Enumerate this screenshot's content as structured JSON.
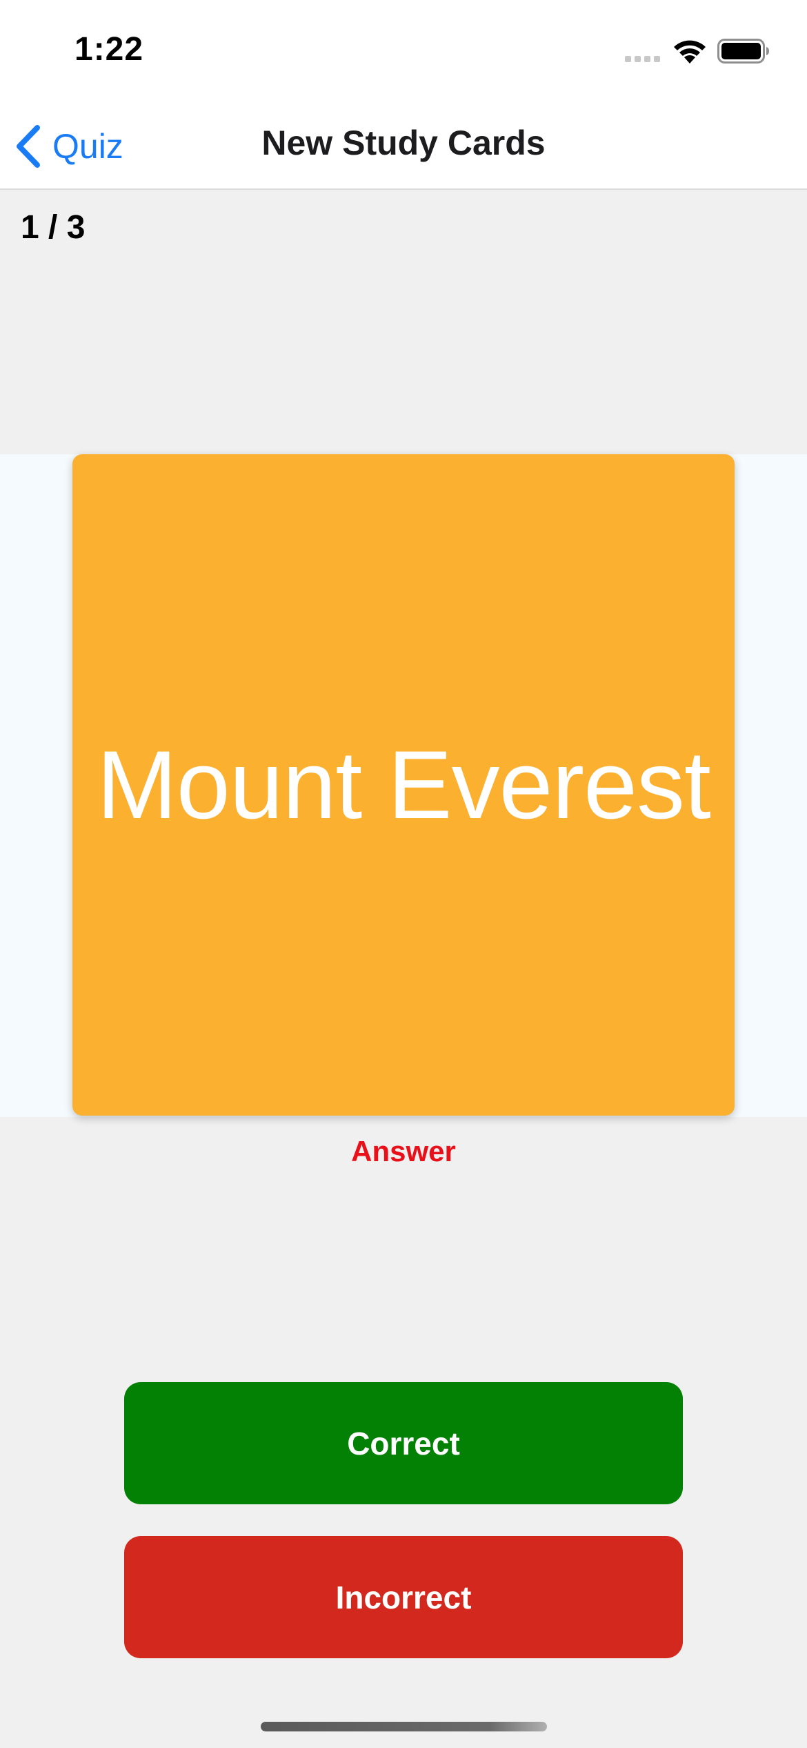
{
  "status_bar": {
    "time": "1:22",
    "cell_icon": "cellular-signal-icon",
    "wifi_icon": "wifi-icon",
    "battery_icon": "battery-icon"
  },
  "nav": {
    "back_label": "Quiz",
    "back_icon": "chevron-left-icon",
    "title": "New Study Cards"
  },
  "progress": "1 / 3",
  "card": {
    "text": "Mount Everest",
    "color": "#fcb02f"
  },
  "answer_label": "Answer",
  "buttons": {
    "correct": "Correct",
    "incorrect": "Incorrect"
  },
  "colors": {
    "accent": "#1a7cf5",
    "correct": "#038104",
    "incorrect": "#d2281d",
    "answer": "#e8111a"
  }
}
